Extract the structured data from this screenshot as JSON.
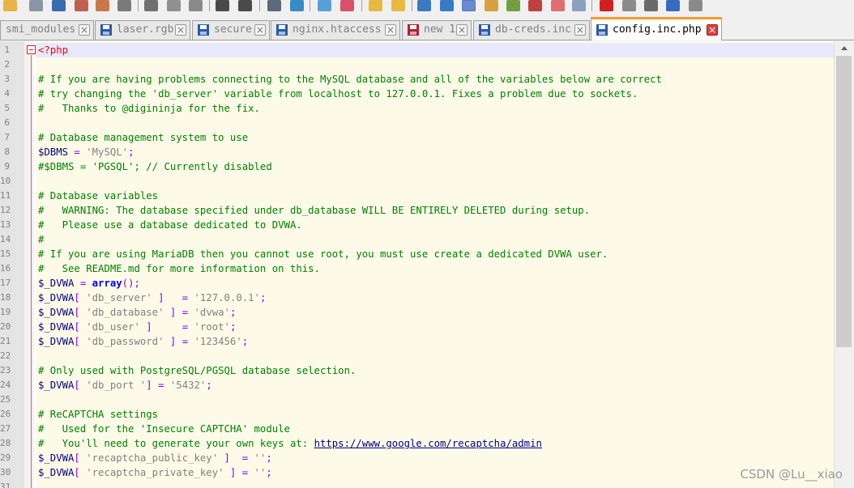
{
  "tabs": [
    {
      "label": "smi_modules",
      "icon": "saved-file-icon",
      "active": false
    },
    {
      "label": "laser.rgb",
      "icon": "saved-file-icon",
      "active": false
    },
    {
      "label": "secure",
      "icon": "saved-file-icon",
      "active": false
    },
    {
      "label": "nginx.htaccess",
      "icon": "saved-file-icon",
      "active": false
    },
    {
      "label": "new 1",
      "icon": "unsaved-file-icon",
      "active": false
    },
    {
      "label": "db-creds.inc",
      "icon": "saved-file-icon",
      "active": false
    },
    {
      "label": "config.inc.php",
      "icon": "saved-file-icon",
      "active": true
    }
  ],
  "tab_close_glyph": "×",
  "editor": {
    "lines": [
      {
        "n": "1",
        "tokens": [
          {
            "t": "<?php",
            "c": "tag"
          }
        ]
      },
      {
        "n": "2",
        "tokens": []
      },
      {
        "n": "3",
        "tokens": [
          {
            "t": "# If you are having problems connecting to the MySQL database and all of the variables below are correct",
            "c": "cmt"
          }
        ]
      },
      {
        "n": "4",
        "tokens": [
          {
            "t": "# try changing the 'db_server' variable from localhost to 127.0.0.1. Fixes a problem due to sockets.",
            "c": "cmt"
          }
        ]
      },
      {
        "n": "5",
        "tokens": [
          {
            "t": "#   Thanks to @digininja for the fix.",
            "c": "cmt"
          }
        ]
      },
      {
        "n": "6",
        "tokens": []
      },
      {
        "n": "7",
        "tokens": [
          {
            "t": "# Database management system to use",
            "c": "cmt"
          }
        ]
      },
      {
        "n": "8",
        "tokens": [
          {
            "t": "$DBMS",
            "c": "var"
          },
          {
            "t": " = ",
            "c": "op"
          },
          {
            "t": "'MySQL'",
            "c": "str"
          },
          {
            "t": ";",
            "c": "op"
          }
        ]
      },
      {
        "n": "9",
        "tokens": [
          {
            "t": "#$DBMS = 'PGSQL'; // Currently disabled",
            "c": "cmt"
          }
        ]
      },
      {
        "n": "10",
        "tokens": []
      },
      {
        "n": "11",
        "tokens": [
          {
            "t": "# Database variables",
            "c": "cmt"
          }
        ]
      },
      {
        "n": "12",
        "tokens": [
          {
            "t": "#   WARNING: The database specified under db_database WILL BE ENTIRELY DELETED during setup.",
            "c": "cmt"
          }
        ]
      },
      {
        "n": "13",
        "tokens": [
          {
            "t": "#   Please use a database dedicated to DVWA.",
            "c": "cmt"
          }
        ]
      },
      {
        "n": "14",
        "tokens": [
          {
            "t": "#",
            "c": "cmt"
          }
        ]
      },
      {
        "n": "15",
        "tokens": [
          {
            "t": "# If you are using MariaDB then you cannot use root, you must use create a dedicated DVWA user.",
            "c": "cmt"
          }
        ]
      },
      {
        "n": "16",
        "tokens": [
          {
            "t": "#   See README.md for more information on this.",
            "c": "cmt"
          }
        ]
      },
      {
        "n": "17",
        "tokens": [
          {
            "t": "$_DVWA",
            "c": "var"
          },
          {
            "t": " = ",
            "c": "op"
          },
          {
            "t": "array",
            "c": "kw"
          },
          {
            "t": "();",
            "c": "op"
          }
        ]
      },
      {
        "n": "18",
        "tokens": [
          {
            "t": "$_DVWA",
            "c": "var"
          },
          {
            "t": "[ ",
            "c": "op"
          },
          {
            "t": "'db_server'",
            "c": "str"
          },
          {
            "t": " ]   = ",
            "c": "op"
          },
          {
            "t": "'127.0.0.1'",
            "c": "str"
          },
          {
            "t": ";",
            "c": "op"
          }
        ]
      },
      {
        "n": "19",
        "tokens": [
          {
            "t": "$_DVWA",
            "c": "var"
          },
          {
            "t": "[ ",
            "c": "op"
          },
          {
            "t": "'db_database'",
            "c": "str"
          },
          {
            "t": " ] = ",
            "c": "op"
          },
          {
            "t": "'dvwa'",
            "c": "str"
          },
          {
            "t": ";",
            "c": "op"
          }
        ]
      },
      {
        "n": "20",
        "tokens": [
          {
            "t": "$_DVWA",
            "c": "var"
          },
          {
            "t": "[ ",
            "c": "op"
          },
          {
            "t": "'db_user'",
            "c": "str"
          },
          {
            "t": " ]     = ",
            "c": "op"
          },
          {
            "t": "'root'",
            "c": "str"
          },
          {
            "t": ";",
            "c": "op"
          }
        ]
      },
      {
        "n": "21",
        "tokens": [
          {
            "t": "$_DVWA",
            "c": "var"
          },
          {
            "t": "[ ",
            "c": "op"
          },
          {
            "t": "'db_password'",
            "c": "str"
          },
          {
            "t": " ] = ",
            "c": "op"
          },
          {
            "t": "'123456'",
            "c": "str"
          },
          {
            "t": ";",
            "c": "op"
          }
        ]
      },
      {
        "n": "22",
        "tokens": []
      },
      {
        "n": "23",
        "tokens": [
          {
            "t": "# Only used with PostgreSQL/PGSQL database selection.",
            "c": "cmt"
          }
        ]
      },
      {
        "n": "24",
        "tokens": [
          {
            "t": "$_DVWA",
            "c": "var"
          },
          {
            "t": "[ ",
            "c": "op"
          },
          {
            "t": "'db_port '",
            "c": "str"
          },
          {
            "t": "] = ",
            "c": "op"
          },
          {
            "t": "'5432'",
            "c": "str"
          },
          {
            "t": ";",
            "c": "op"
          }
        ]
      },
      {
        "n": "25",
        "tokens": []
      },
      {
        "n": "26",
        "tokens": [
          {
            "t": "# ReCAPTCHA settings",
            "c": "cmt"
          }
        ]
      },
      {
        "n": "27",
        "tokens": [
          {
            "t": "#   Used for the 'Insecure CAPTCHA' module",
            "c": "cmt"
          }
        ]
      },
      {
        "n": "28",
        "tokens": [
          {
            "t": "#   You'll need to generate your own keys at: ",
            "c": "cmt"
          },
          {
            "t": "https://www.google.com/recaptcha/admin",
            "c": "url"
          }
        ]
      },
      {
        "n": "29",
        "tokens": [
          {
            "t": "$_DVWA",
            "c": "var"
          },
          {
            "t": "[ ",
            "c": "op"
          },
          {
            "t": "'recaptcha_public_key'",
            "c": "str"
          },
          {
            "t": " ]  = ",
            "c": "op"
          },
          {
            "t": "''",
            "c": "str"
          },
          {
            "t": ";",
            "c": "op"
          }
        ]
      },
      {
        "n": "30",
        "tokens": [
          {
            "t": "$_DVWA",
            "c": "var"
          },
          {
            "t": "[ ",
            "c": "op"
          },
          {
            "t": "'recaptcha_private_key'",
            "c": "str"
          },
          {
            "t": " ] = ",
            "c": "op"
          },
          {
            "t": "''",
            "c": "str"
          },
          {
            "t": ";",
            "c": "op"
          }
        ]
      },
      {
        "n": "31",
        "tokens": []
      }
    ]
  },
  "watermark": "CSDN @Lu__xiao",
  "colors": {
    "comment": "#008000",
    "string": "#808080",
    "variable": "#000080",
    "operator": "#8000ff",
    "keyword": "#0000ff",
    "php_tag": "#ff0000",
    "active_tab_accent": "#fa9a28",
    "editor_background": "#fdfbe8",
    "current_line": "#e8e8ff"
  }
}
